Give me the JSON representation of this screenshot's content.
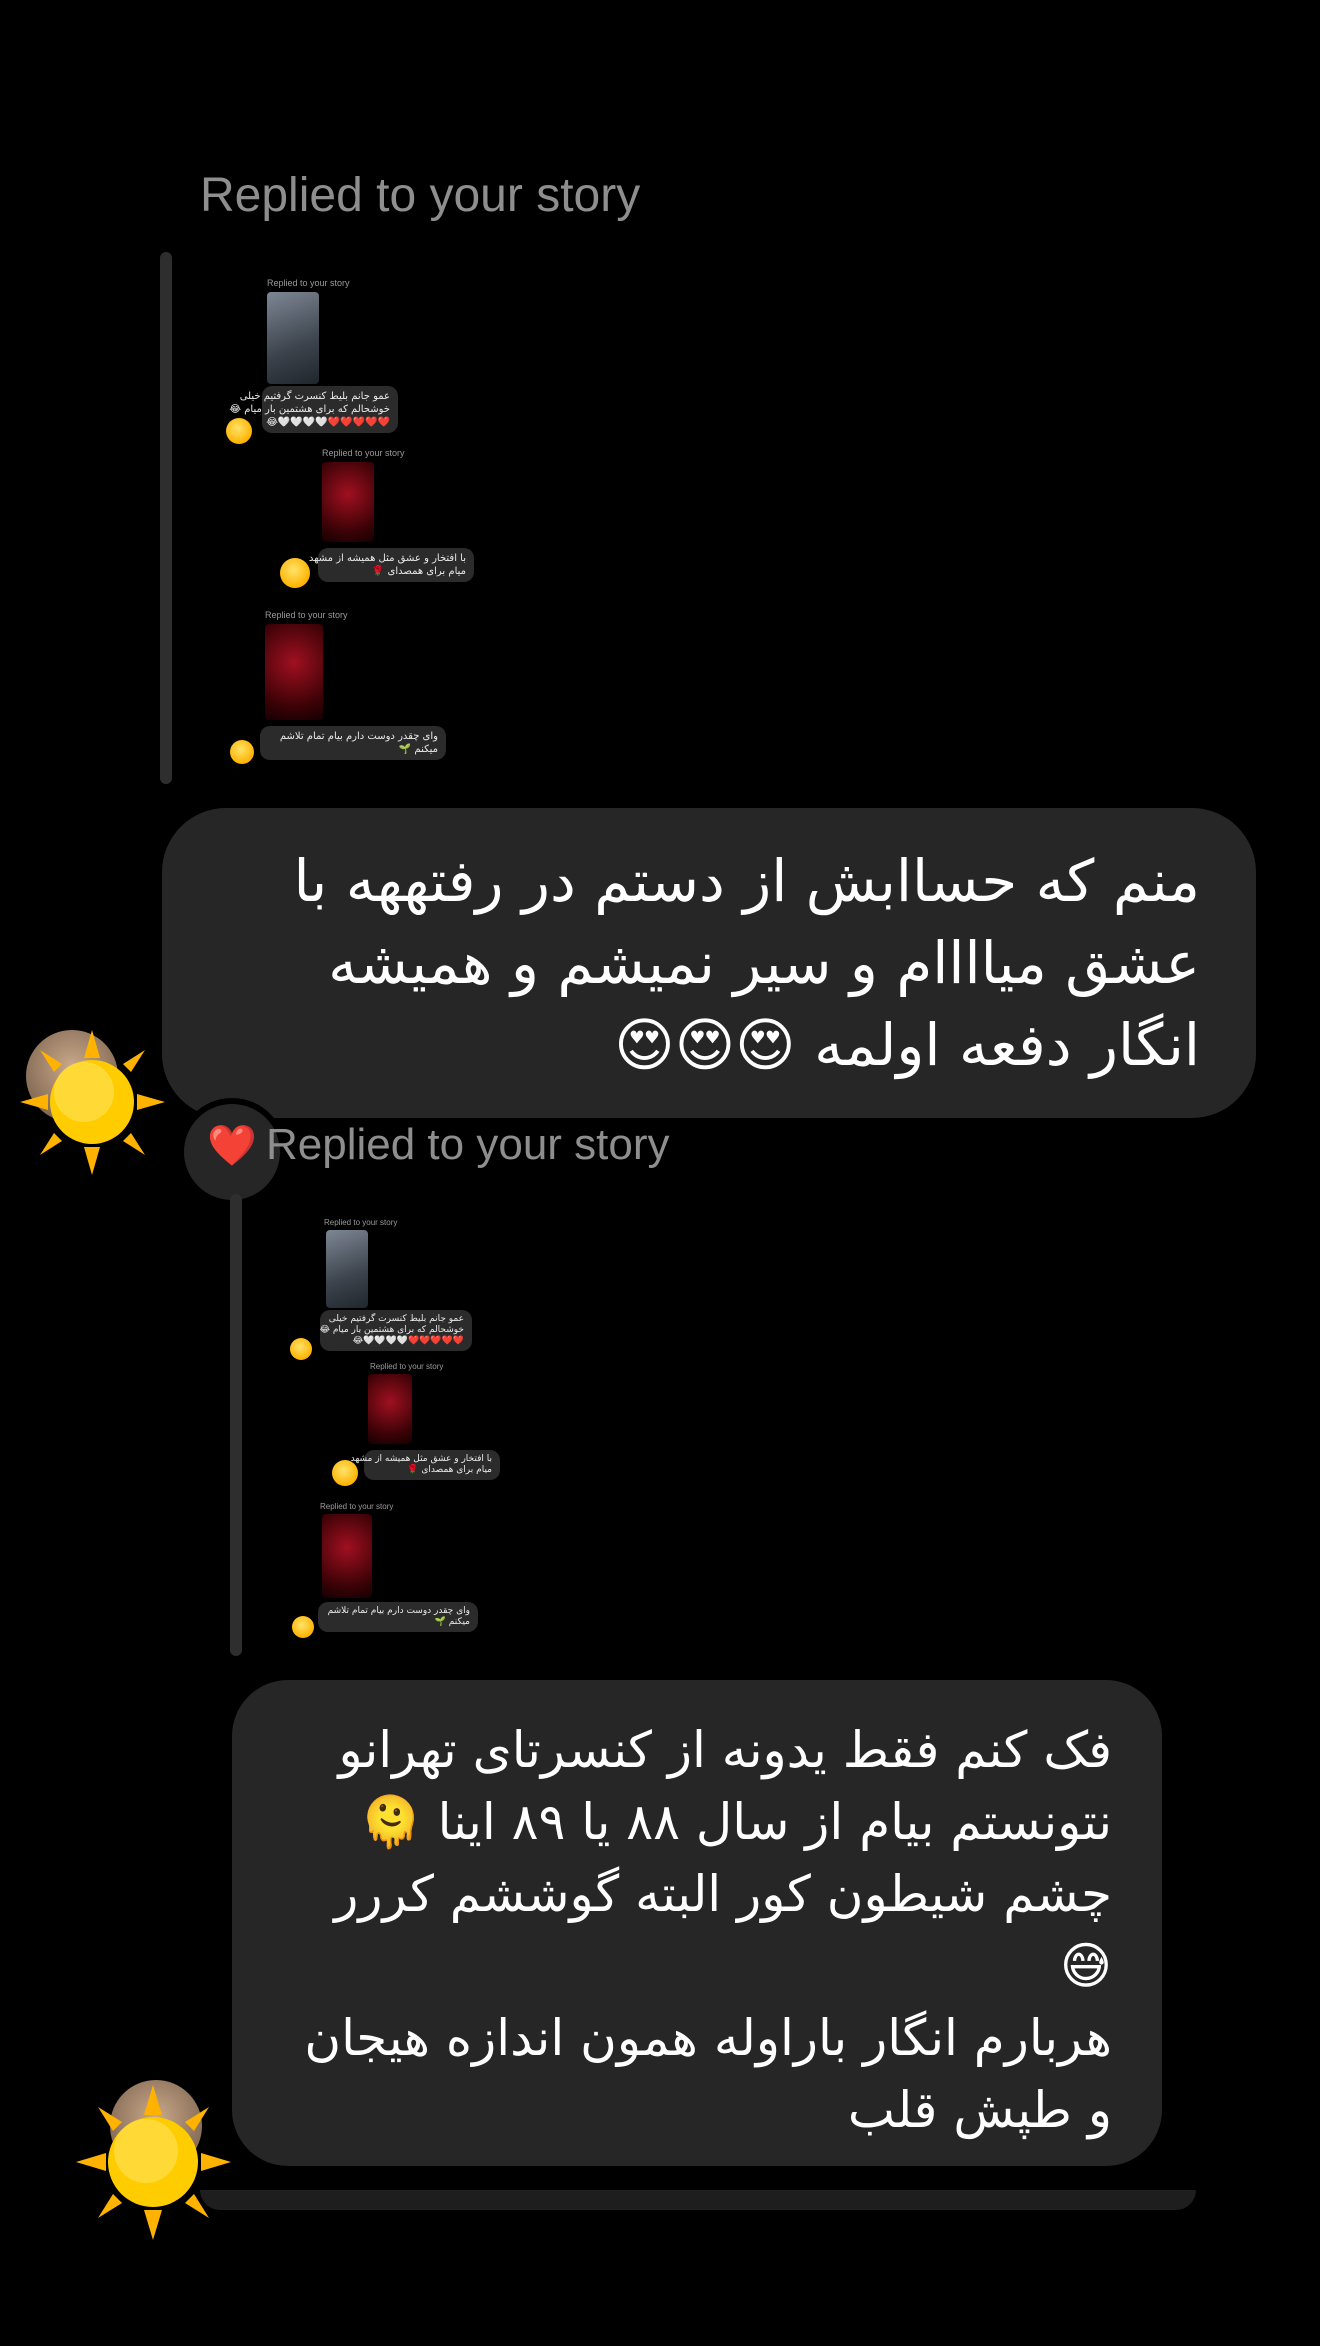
{
  "thread": {
    "replied_label_1": "Replied to your story",
    "replied_label_2": "Replied to your story",
    "message_1": {
      "line_1": "منم که حساابش از دستم در رفتههه با",
      "line_2": "عشق میاااام و سیر نمیشم و همیشه",
      "line_3": "انگار دفعه اولمه",
      "emojis": "😍😍😍"
    },
    "message_2": {
      "line_1": "فک کنم فقط یدونه از کنسرتای تهرانو",
      "line_2": "نتونستم بیام از سال ۸۸ یا ۸۹ اینا",
      "line_2_emoji": "🫠",
      "line_3": "چشم شیطون کور البته گوششم کررر",
      "line_4_emoji": "😅",
      "line_5": "هربارم انگار باراوله همون اندازه هیجان",
      "line_6": "و طپش قلب"
    },
    "reaction_emoji": "❤️",
    "avatar_sticker_icon": "sun-icon"
  },
  "story_preview": {
    "replied_label": "Replied to your story",
    "reply_1": "عمو جانم بلیط کنسرت گرفتیم خیلی",
    "reply_1b": "خوشحالم که برای هشتمین بار میام 😂",
    "reply_1_hearts": "❤️❤️❤️❤️❤️🤍🤍🤍🤍😂",
    "reply_2": "با افتخار و عشق مثل همیشه از مشهد",
    "reply_2b": "میام برای همصدای 🌹",
    "reply_3": "وای چقدر دوست دارم بیام تمام تلاشم",
    "reply_3b": "میکنم 🌱",
    "reaction": "❤️"
  }
}
